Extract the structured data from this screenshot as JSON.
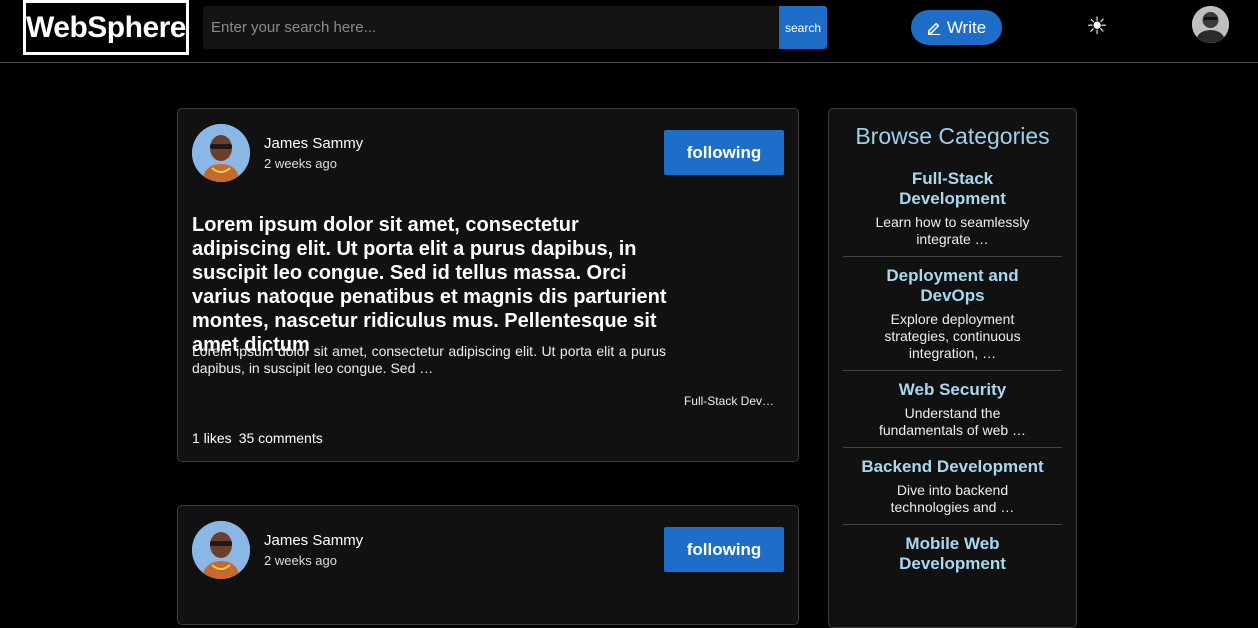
{
  "header": {
    "logo": "WebSphere",
    "search_placeholder": "Enter your search here...",
    "search_label": "search",
    "write_label": "Write",
    "theme_icon": "sun-icon"
  },
  "posts": [
    {
      "author": "James Sammy",
      "time": "2 weeks ago",
      "follow_label": "following",
      "title": "Lorem ipsum dolor sit amet, consectetur adipiscing elit. Ut porta elit a purus dapibus, in suscipit leo congue. Sed id tellus massa. Orci varius natoque penatibus et magnis dis parturient montes, nascetur ridiculus mus. Pellentesque sit amet dictum",
      "excerpt": "Lorem ipsum dolor sit amet, consectetur adipiscing elit. Ut porta elit a purus dapibus, in suscipit leo congue. Sed …",
      "category": "Full-Stack Dev…",
      "likes": "1 likes",
      "comments": "35 comments"
    },
    {
      "author": "James Sammy",
      "time": "2 weeks ago",
      "follow_label": "following"
    }
  ],
  "sidebar": {
    "title": "Browse Categories",
    "categories": [
      {
        "name": "Full-Stack Development",
        "desc": "Learn how to seamlessly integrate …"
      },
      {
        "name": "Deployment and DevOps",
        "desc": "Explore deployment strategies, continuous integration, …"
      },
      {
        "name": "Web Security",
        "desc": "Understand the fundamentals of web …"
      },
      {
        "name": "Backend Development",
        "desc": "Dive into backend technologies and …"
      },
      {
        "name": "Mobile Web Development",
        "desc": ""
      }
    ]
  },
  "colors": {
    "accent": "#1e6dc8",
    "category_heading": "#a8d8ef",
    "card_bg": "#111111"
  }
}
